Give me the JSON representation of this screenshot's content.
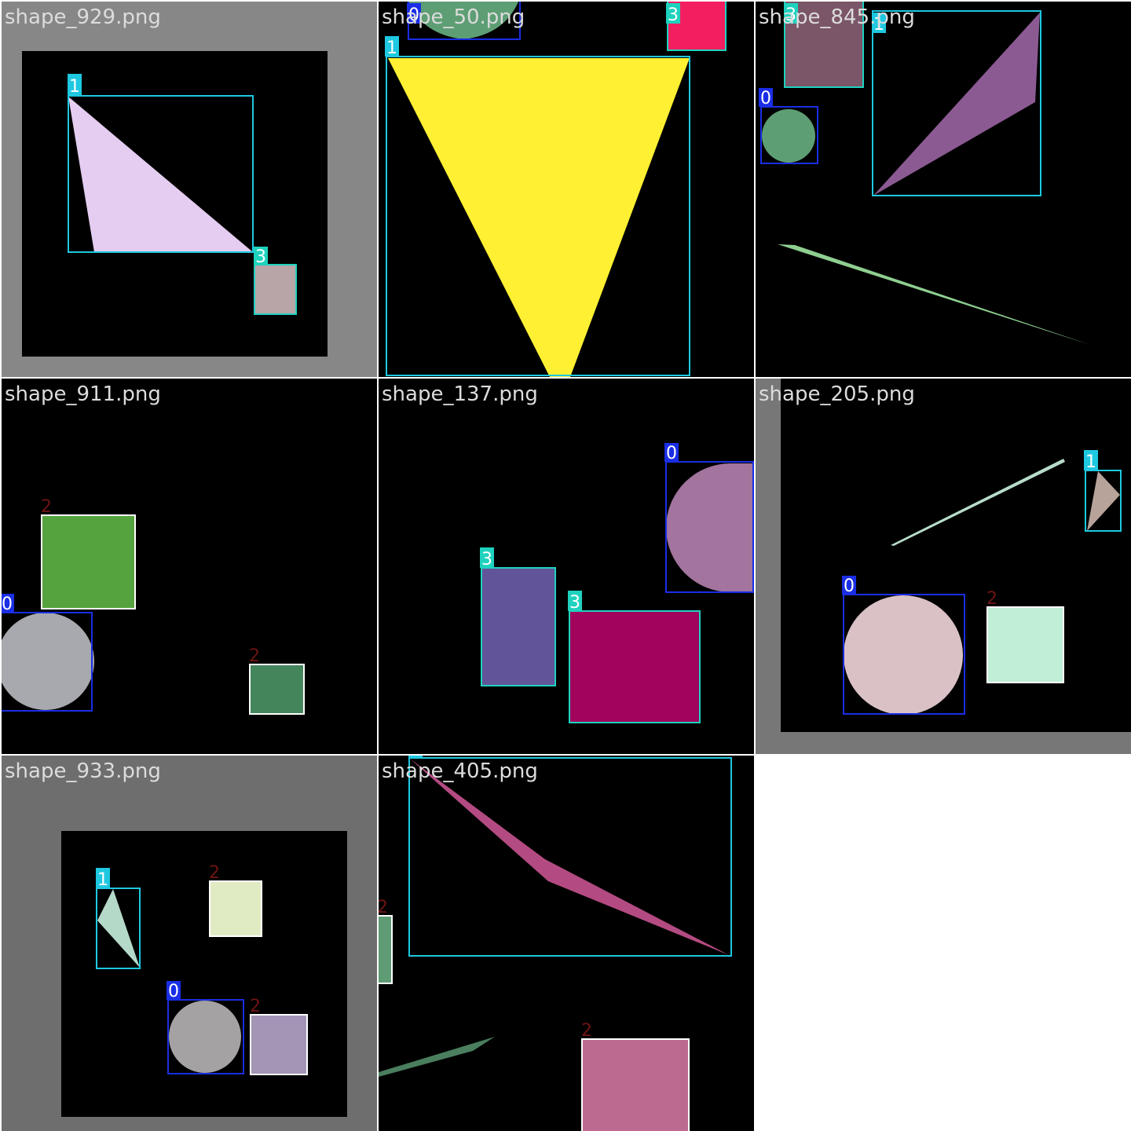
{
  "mosaic": {
    "tiles": [
      {
        "filename": "shape_929.png"
      },
      {
        "filename": "shape_50.png"
      },
      {
        "filename": "shape_845.png"
      },
      {
        "filename": "shape_911.png"
      },
      {
        "filename": "shape_137.png"
      },
      {
        "filename": "shape_205.png"
      },
      {
        "filename": "shape_933.png"
      },
      {
        "filename": "shape_405.png"
      }
    ]
  },
  "class_labels": [
    "0",
    "1",
    "2",
    "3"
  ],
  "class_colors": {
    "0": "#1a2ee6",
    "1": "#1ec8e0",
    "2": "#ffffff",
    "3": "#1ed2be"
  },
  "label_text_colors": {
    "0": "#ffffff",
    "1": "#ffffff",
    "2": "#6e1414",
    "3": "#ffffff"
  }
}
